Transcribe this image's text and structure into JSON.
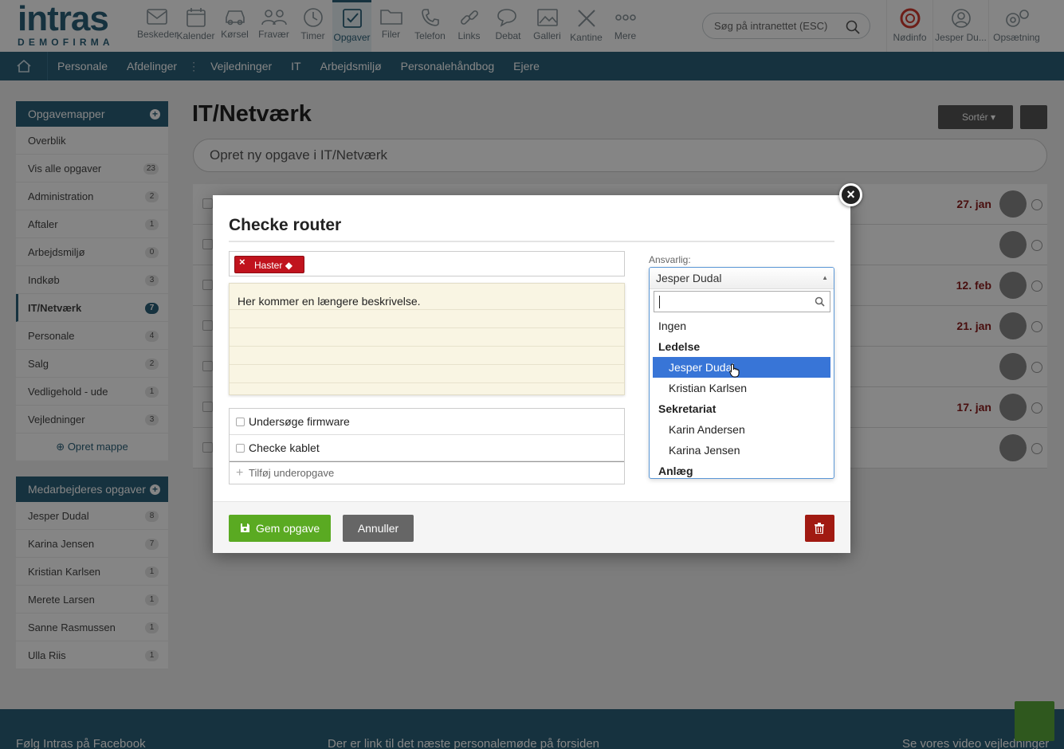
{
  "header": {
    "logo": "intras",
    "logo_sub": "DEMOFIRMA",
    "nav": [
      {
        "label": "Beskeder",
        "icon": "mail-icon"
      },
      {
        "label": "Kalender",
        "icon": "calendar-icon"
      },
      {
        "label": "Kørsel",
        "icon": "car-icon"
      },
      {
        "label": "Fravær",
        "icon": "people-icon"
      },
      {
        "label": "Timer",
        "icon": "clock-icon"
      },
      {
        "label": "Opgaver",
        "icon": "checkbox-icon"
      },
      {
        "label": "Filer",
        "icon": "folder-icon"
      },
      {
        "label": "Telefon",
        "icon": "phone-icon"
      },
      {
        "label": "Links",
        "icon": "link-icon"
      },
      {
        "label": "Debat",
        "icon": "chat-icon"
      },
      {
        "label": "Galleri",
        "icon": "image-icon"
      },
      {
        "label": "Kantine",
        "icon": "cutlery-icon"
      },
      {
        "label": "Mere",
        "icon": "dots-icon"
      }
    ],
    "search_placeholder": "Søg på intranettet (ESC)",
    "right": [
      {
        "label": "Nødinfo",
        "icon": "lifebuoy-icon"
      },
      {
        "label": "Jesper Du...",
        "icon": "user-icon"
      },
      {
        "label": "Opsætning",
        "icon": "gears-icon"
      }
    ]
  },
  "subnav": [
    "Personale",
    "Afdelinger",
    "Vejledninger",
    "IT",
    "Arbejdsmiljø",
    "Personalehåndbog",
    "Ejere"
  ],
  "sidebar": {
    "folders_title": "Opgavemapper",
    "folders": [
      {
        "label": "Overblik",
        "count": ""
      },
      {
        "label": "Vis alle opgaver",
        "count": "23"
      },
      {
        "label": "Administration",
        "count": "2"
      },
      {
        "label": "Aftaler",
        "count": "1"
      },
      {
        "label": "Arbejdsmiljø",
        "count": "0"
      },
      {
        "label": "Indkøb",
        "count": "3"
      },
      {
        "label": "IT/Netværk",
        "count": "7"
      },
      {
        "label": "Personale",
        "count": "4"
      },
      {
        "label": "Salg",
        "count": "2"
      },
      {
        "label": "Vedligehold - ude",
        "count": "1"
      },
      {
        "label": "Vejledninger",
        "count": "3"
      }
    ],
    "add_folder": "Opret mappe",
    "staff_title": "Medarbejderes opgaver",
    "staff": [
      {
        "label": "Jesper Dudal",
        "count": "8"
      },
      {
        "label": "Karina Jensen",
        "count": "7"
      },
      {
        "label": "Kristian Karlsen",
        "count": "1"
      },
      {
        "label": "Merete Larsen",
        "count": "1"
      },
      {
        "label": "Sanne Rasmussen",
        "count": "1"
      },
      {
        "label": "Ulla Riis",
        "count": "1"
      }
    ]
  },
  "main": {
    "title": "IT/Netværk",
    "sort_label": "Sortér",
    "new_task_placeholder": "Opret ny opgave i IT/Netværk",
    "rows": [
      {
        "date": "27. jan"
      },
      {
        "date": ""
      },
      {
        "date": "12. feb"
      },
      {
        "date": "21. jan"
      },
      {
        "date": ""
      },
      {
        "date": "17. jan"
      },
      {
        "date": ""
      }
    ]
  },
  "footer": {
    "left": "Følg Intras på Facebook",
    "center": "Der er link til det næste personalemøde på forsiden",
    "right": "Se vores video vejledninger"
  },
  "modal": {
    "title": "Checke router",
    "tag": "Haster",
    "description": "Her kommer en længere beskrivelse.",
    "subtasks": [
      "Undersøge firmware",
      "Checke kablet"
    ],
    "add_subtask": "Tilføj underopgave",
    "responsible_label": "Ansvarlig:",
    "responsible_value": "Jesper Dudal",
    "options": [
      {
        "label": "Ingen",
        "type": "option"
      },
      {
        "label": "Ledelse",
        "type": "group"
      },
      {
        "label": "Jesper Dudal",
        "type": "child",
        "selected": true
      },
      {
        "label": "Kristian Karlsen",
        "type": "child"
      },
      {
        "label": "Sekretariat",
        "type": "group"
      },
      {
        "label": "Karin Andersen",
        "type": "child"
      },
      {
        "label": "Karina Jensen",
        "type": "child"
      },
      {
        "label": "Anlæg",
        "type": "group"
      }
    ],
    "save_label": "Gem opgave",
    "cancel_label": "Annuller"
  },
  "colors": {
    "brand": "#2b6079",
    "save": "#5aaa22",
    "delete": "#a11a12",
    "tag": "#c0131d",
    "date": "#8b1b1b"
  }
}
